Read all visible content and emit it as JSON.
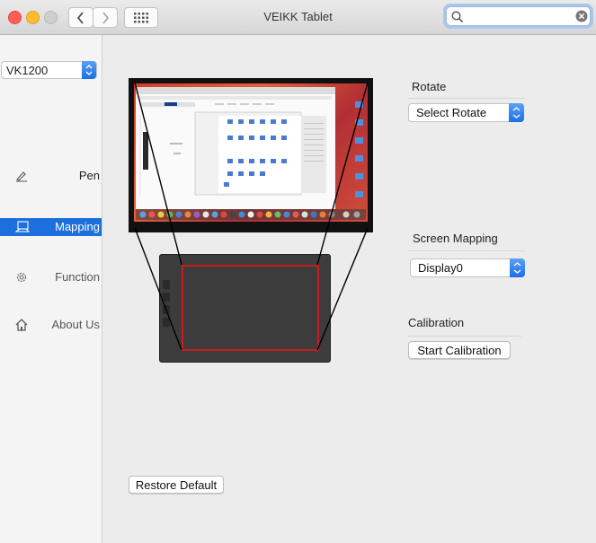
{
  "window": {
    "title": "VEIKK Tablet"
  },
  "search": {
    "value": "",
    "placeholder": ""
  },
  "sidebar": {
    "device": "VK1200",
    "items": [
      {
        "label": "Pen",
        "icon": "pen-icon"
      },
      {
        "label": "Mapping",
        "icon": "mapping-icon",
        "selected": true
      },
      {
        "label": "Function",
        "icon": "gear-icon"
      },
      {
        "label": "About Us",
        "icon": "home-icon"
      }
    ]
  },
  "rotate": {
    "label": "Rotate",
    "value": "Select Rotate"
  },
  "screen_mapping": {
    "label": "Screen Mapping",
    "value": "Display0"
  },
  "calibration": {
    "label": "Calibration",
    "button": "Start Calibration"
  },
  "restore_button": "Restore Default",
  "colors": {
    "accent": "#1c6fdc",
    "mapping_area": "#c91c1c"
  }
}
